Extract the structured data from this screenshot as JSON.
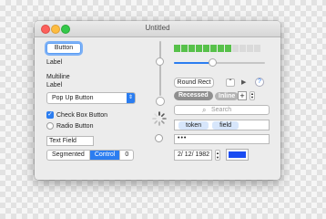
{
  "window": {
    "title": "Untitled"
  },
  "left": {
    "button_label": "Button",
    "label": "Label",
    "multiline_label": "Multiline\nLabel",
    "popup_label": "Pop Up Button",
    "checkbox_label": "Check Box Button",
    "radio_label": "Radio Button",
    "text_field_value": "Text Field",
    "segmented": {
      "segments": [
        "Segmented",
        "Control",
        "0"
      ],
      "selected": "Control"
    }
  },
  "right": {
    "level_indicator": {
      "filled": 8,
      "total": 12
    },
    "slider_value": 0.42,
    "round_rect_label": "Round Rect",
    "recessed_label": "Recessed",
    "inline_label": "Inline",
    "help_label": "?",
    "search_placeholder": "Search",
    "tokens": [
      "token",
      "field"
    ],
    "secure_dots": "•••",
    "date_value": "2/ 12/ 1982",
    "color_well": "#1a4cf2"
  },
  "colors": {
    "accent": "#2b7df0",
    "level_on": "#57c14a"
  },
  "icons": [
    "close-icon",
    "minimize-icon",
    "zoom-icon",
    "checkmark-icon",
    "popup-arrows-icon",
    "spinner-icon",
    "disclosure-triangle-icon",
    "play-icon",
    "search-icon",
    "stepper-icon",
    "plus-icon",
    "help-icon"
  ]
}
